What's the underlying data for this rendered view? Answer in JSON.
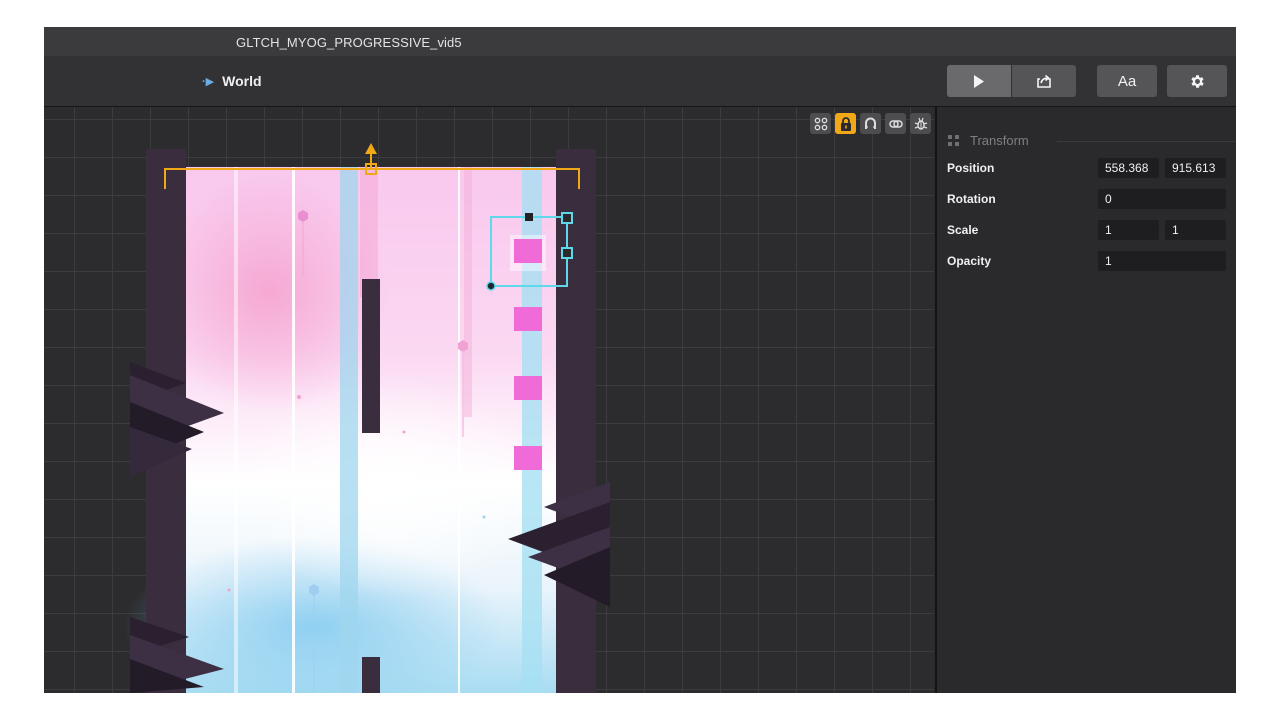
{
  "window": {
    "title": "GLTCH_MYOG_PROGRESSIVE_vid5"
  },
  "toolbar": {
    "breadcrumb": "World",
    "font_button": "Aa",
    "icons": [
      "play-icon",
      "share-icon",
      "gear-icon"
    ]
  },
  "viewport": {
    "tool_icons": [
      "pin-icon",
      "lock-icon",
      "magnet-icon",
      "link-icon",
      "bug-icon"
    ],
    "active_tool": "lock-icon"
  },
  "inspector": {
    "section_title": "Transform",
    "position": {
      "label": "Position",
      "x": "558.368",
      "y": "915.613"
    },
    "rotation": {
      "label": "Rotation",
      "value": "0"
    },
    "scale": {
      "label": "Scale",
      "x": "1",
      "y": "1"
    },
    "opacity": {
      "label": "Opacity",
      "value": "1"
    }
  },
  "colors": {
    "selection_orange": "#f0a817",
    "selection_cyan": "#5fd8ea",
    "cube_pink": "#f06ad8",
    "wall_purple": "#3a2e3e",
    "panel_bg": "#2a2a2c"
  }
}
